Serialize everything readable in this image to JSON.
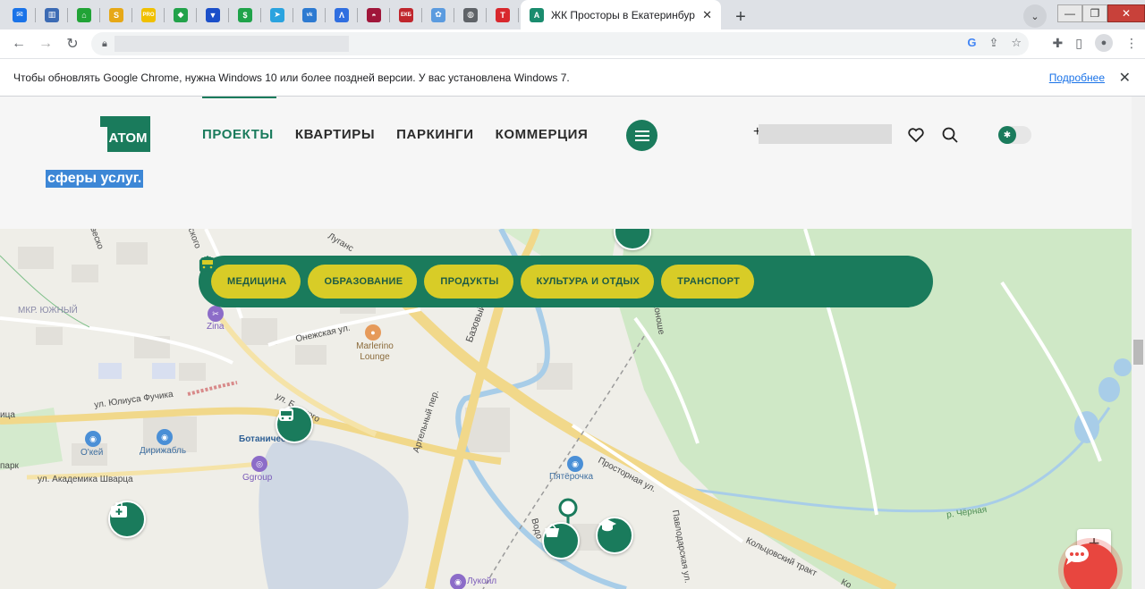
{
  "browser": {
    "pinned_tabs": [
      {
        "icon": "mail-icon",
        "color": "#1a73e8",
        "glyph": "✉"
      },
      {
        "icon": "bank-icon",
        "color": "#3c6bb4",
        "glyph": "▥"
      },
      {
        "icon": "home-icon",
        "color": "#21a336",
        "glyph": "⌂"
      },
      {
        "icon": "news-icon",
        "color": "#e6a817",
        "glyph": "S"
      },
      {
        "icon": "pro-icon",
        "color": "#f0c000",
        "glyph": "PRO"
      },
      {
        "icon": "brazil-icon",
        "color": "#22a24a",
        "glyph": "◆"
      },
      {
        "icon": "vpn-icon",
        "color": "#1b4fc9",
        "glyph": "▼"
      },
      {
        "icon": "dollar-icon",
        "color": "#1fa34a",
        "glyph": "$"
      },
      {
        "icon": "telegram-icon",
        "color": "#2aa3df",
        "glyph": "➤"
      },
      {
        "icon": "vk-icon",
        "color": "#2d7ad1",
        "glyph": "vk"
      },
      {
        "icon": "arrow-logo-icon",
        "color": "#2f6ee0",
        "glyph": "Λ"
      },
      {
        "icon": "lips-icon",
        "color": "#a0163a",
        "glyph": "◓"
      },
      {
        "icon": "ekb-icon",
        "color": "#c0262d",
        "glyph": "ЕКБ"
      },
      {
        "icon": "apps-icon",
        "color": "#5b9bdf",
        "glyph": "✿"
      },
      {
        "icon": "globe-icon",
        "color": "#5f6368",
        "glyph": "◍"
      },
      {
        "icon": "t-icon",
        "color": "#d8282d",
        "glyph": "T"
      }
    ],
    "active_tab": {
      "title": "ЖК Просторы в Екатеринбург -",
      "favicon_glyph": "А"
    },
    "update_message": "Чтобы обновлять Google Chrome, нужна Windows 10 или более поздней версии. У вас установлена Windows 7.",
    "update_link": "Подробнее"
  },
  "site": {
    "logo_text": "АТОМ",
    "nav": [
      "ПРОЕКТЫ",
      "КВАРТИРЫ",
      "ПАРКИНГИ",
      "КОММЕРЦИЯ"
    ],
    "phone_prefix": "+",
    "selected_text": "сферы услуг.",
    "accent": "#1a7b5c",
    "chip_color": "#d8cc27"
  },
  "filters": [
    {
      "label": "МЕДИЦИНА",
      "icon": "medkit-icon"
    },
    {
      "label": "ОБРАЗОВАНИЕ",
      "icon": "graduation-cap-icon"
    },
    {
      "label": "ПРОДУКТЫ",
      "icon": "basket-icon"
    },
    {
      "label": "КУЛЬТУРА И ОТДЫХ",
      "icon": "star-ticket-icon"
    },
    {
      "label": "ТРАНСПОРТ",
      "icon": "bus-icon"
    }
  ],
  "map_labels": {
    "yuzhny": "МКР. ЮЖНЫЙ",
    "zina": "Zina",
    "onezhskaya": "Онежская ул.",
    "marlerino": "Marlerino\nLounge",
    "fuchika": "ул. Юлиуса Фучика",
    "botanich": "Ботаничес",
    "okey": "О'кей",
    "dirizhabl": "Дирижабль",
    "ggroup": "Ggroup",
    "shvartsa": "ул. Академика Шварца",
    "park": "парк",
    "tsa": "ица",
    "artelny": "Артельный пер.",
    "bazovy": "Базовый",
    "lugansk": "Луганс",
    "pyaterochka": "Пятёрочка",
    "prostornaya": "Просторная ул.",
    "pavlodarskaya": "Павлодарская ул.",
    "koltsovsky": "Кольцовский тракт",
    "konoshe": "Коноше",
    "chernaya": "р. Чёрная",
    "lukoil": "Лукойл",
    "sky": "ского",
    "vodo": "Водо",
    "esco": "веско",
    "blagodat": "ул. Б...ского",
    "ko": "Ко"
  }
}
